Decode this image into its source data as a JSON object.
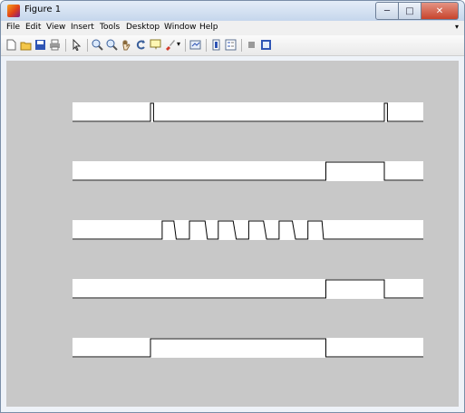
{
  "window": {
    "title": "Figure 1",
    "controls": {
      "minimize": "─",
      "maximize": "□",
      "close": "✕"
    }
  },
  "menu": {
    "items": [
      "File",
      "Edit",
      "View",
      "Insert",
      "Tools",
      "Desktop",
      "Window",
      "Help"
    ],
    "overflow": "▾"
  },
  "toolbar": {
    "icons": [
      "new-figure-icon",
      "open-file-icon",
      "save-icon",
      "print-icon",
      "edit-plot-arrow-icon",
      "zoom-in-icon",
      "zoom-out-icon",
      "pan-hand-icon",
      "rotate-3d-icon",
      "data-cursor-icon",
      "brush-icon",
      "link-plot-icon",
      "colorbar-icon",
      "legend-icon",
      "hide-plot-tools-icon",
      "show-plot-tools-icon"
    ]
  },
  "colors": {
    "figure_background": "#c8c8c8",
    "axes_background": "#ffffff",
    "trace": "#000000"
  },
  "chart_data": [
    {
      "type": "line",
      "x": [
        0,
        1,
        1,
        1.04,
        1.04,
        4,
        4,
        4.04,
        4.04,
        4.5
      ],
      "y": [
        0,
        0,
        1,
        1,
        0,
        0,
        1,
        1,
        0,
        0
      ],
      "xlim": [
        0,
        4.5
      ],
      "ylim": [
        0,
        1
      ],
      "grid": false
    },
    {
      "type": "line",
      "x": [
        0,
        3.25,
        3.25,
        4,
        4,
        4.5
      ],
      "y": [
        0,
        0,
        1,
        1,
        0,
        0
      ],
      "xlim": [
        0,
        4.5
      ],
      "ylim": [
        0,
        1
      ],
      "grid": false
    },
    {
      "type": "line",
      "x": [
        0,
        1.15,
        1.15,
        1.3,
        1.33,
        1.5,
        1.5,
        1.7,
        1.73,
        1.87,
        1.87,
        2.06,
        2.1,
        2.26,
        2.26,
        2.45,
        2.49,
        2.65,
        2.65,
        2.82,
        2.86,
        3.02,
        3.02,
        3.2,
        3.22,
        3.25,
        4.5
      ],
      "y": [
        0,
        0,
        1,
        1,
        0,
        0,
        1,
        1,
        0,
        0,
        1,
        1,
        0,
        0,
        1,
        1,
        0,
        0,
        1,
        1,
        0,
        0,
        1,
        1,
        0,
        0,
        0
      ],
      "xlim": [
        0,
        4.5
      ],
      "ylim": [
        0,
        1
      ],
      "grid": false
    },
    {
      "type": "line",
      "x": [
        0,
        3.25,
        3.25,
        4,
        4,
        4.5
      ],
      "y": [
        0,
        0,
        1,
        1,
        0,
        0
      ],
      "xlim": [
        0,
        4.5
      ],
      "ylim": [
        0,
        1
      ],
      "grid": false
    },
    {
      "type": "line",
      "x": [
        0,
        1,
        1,
        3.25,
        3.25,
        4.5
      ],
      "y": [
        0,
        0,
        1,
        1,
        0,
        0
      ],
      "xlim": [
        0,
        4.5
      ],
      "ylim": [
        0,
        1
      ],
      "grid": false
    }
  ]
}
